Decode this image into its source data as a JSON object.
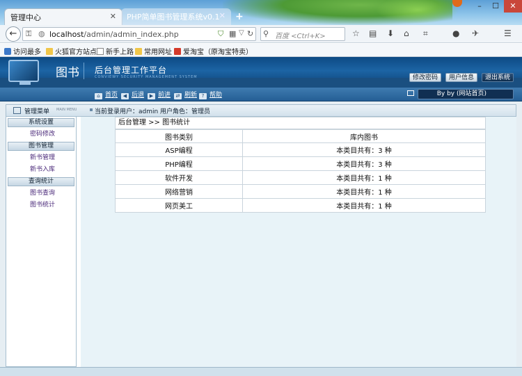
{
  "browser": {
    "tabs": [
      {
        "label": "管理中心",
        "active": true
      },
      {
        "label": "PHP简单图书管理系统v0.1",
        "active": false
      }
    ],
    "address": {
      "host": "localhost",
      "path": "/admin/admin_index.php"
    },
    "search_placeholder": "百度 <Ctrl+K>",
    "bookmarks": [
      "访问最多",
      "火狐官方站点",
      "新手上路",
      "常用网址",
      "爱淘宝（原淘宝特卖）"
    ]
  },
  "header": {
    "brand": "图书",
    "platform_title": "后台管理工作平台",
    "platform_subtitle": "CONVIEWY SECURITY MANAGEMENT SYSTEM",
    "buttons": {
      "change_password": "修改密码",
      "user_info": "用户信息",
      "logout": "退出系统"
    }
  },
  "toolbar": {
    "links": [
      "首页",
      "后退",
      "前进",
      "刷新",
      "帮助"
    ],
    "user": "By by (网站首页)"
  },
  "infobar": {
    "menu_label": "管理菜单",
    "menu_sub": "MAIN MENU",
    "login_text": "当前登录用户：admin  用户角色：管理员"
  },
  "sidebar": {
    "sections": [
      {
        "title": "系统设置",
        "items": [
          "密码修改"
        ]
      },
      {
        "title": "图书管理",
        "items": [
          "新书管理",
          "新书入库"
        ]
      },
      {
        "title": "查询统计",
        "items": [
          "图书查询",
          "图书统计"
        ]
      }
    ]
  },
  "content": {
    "breadcrumb": "后台管理 >> 图书统计",
    "table": {
      "headers": [
        "图书类别",
        "库内图书"
      ],
      "rows": [
        [
          "ASP编程",
          "本类目共有：3 种"
        ],
        [
          "PHP编程",
          "本类目共有：3 种"
        ],
        [
          "软件开发",
          "本类目共有：1 种"
        ],
        [
          "网络营销",
          "本类目共有：1 种"
        ],
        [
          "网页美工",
          "本类目共有：1 种"
        ]
      ]
    }
  }
}
